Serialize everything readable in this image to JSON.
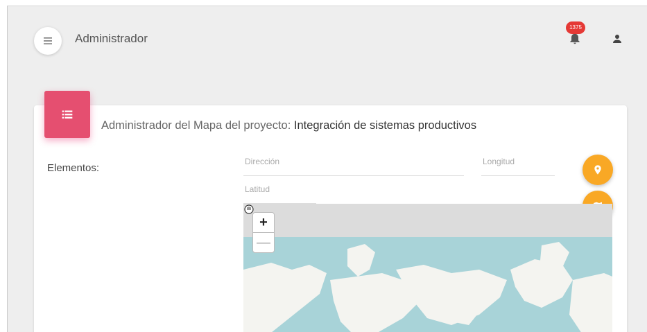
{
  "header": {
    "title": "Administrador",
    "notification_count": "1375"
  },
  "card": {
    "title_prefix": "Administrador del Mapa del proyecto: ",
    "project_name": "Integración de sistemas productivos",
    "elements_label": "Elementos:"
  },
  "form": {
    "direccion_placeholder": "Dirección",
    "longitud_placeholder": "Longitud",
    "latitud_placeholder": "Latitud"
  },
  "map": {
    "zoom_in_label": "+",
    "zoom_out_label": "—"
  },
  "colors": {
    "accent_pink": "#e54f70",
    "fab_orange": "#f9a825",
    "badge_red": "#e53935",
    "ocean": "#a8d3d8",
    "land": "#f4f4f0"
  }
}
